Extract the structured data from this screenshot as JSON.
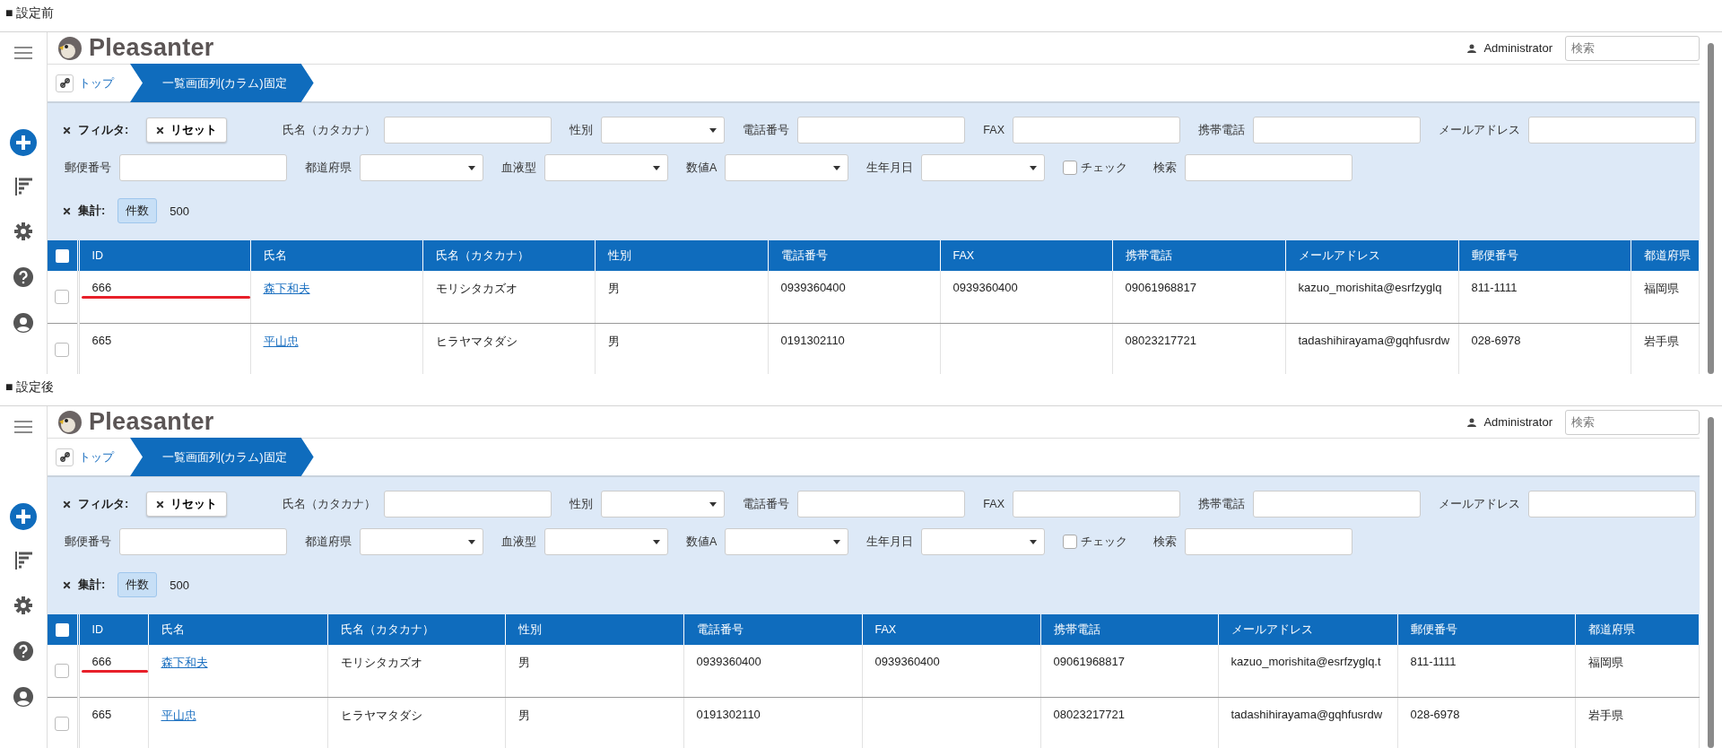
{
  "panels": [
    {
      "caption": "■ 設定前",
      "id_column_narrow": false,
      "logo": {
        "text": "Pleasanter"
      },
      "user": {
        "name": "Administrator"
      },
      "search": {
        "placeholder": "検索"
      },
      "breadcrumb": [
        {
          "kind": "link",
          "label": "トップ"
        },
        {
          "kind": "current",
          "label": "一覧画面列(カラム)固定"
        }
      ],
      "filter": {
        "title": "フィルタ:",
        "reset": "リセット",
        "lines": [
          {
            "fields": [
              {
                "kind": "text",
                "label": "氏名（カタカナ）"
              },
              {
                "kind": "select",
                "label": "性別"
              },
              {
                "kind": "text",
                "label": "電話番号"
              },
              {
                "kind": "text",
                "label": "FAX"
              },
              {
                "kind": "text",
                "label": "携帯電話"
              },
              {
                "kind": "text",
                "label": "メールアドレス"
              }
            ]
          },
          {
            "fields": [
              {
                "kind": "text",
                "label": "郵便番号"
              },
              {
                "kind": "select",
                "label": "都道府県"
              },
              {
                "kind": "select",
                "label": "血液型"
              },
              {
                "kind": "select",
                "label": "数値A"
              },
              {
                "kind": "select",
                "label": "生年月日"
              },
              {
                "kind": "checkbox",
                "label": "チェック",
                "checked": false
              },
              {
                "kind": "text",
                "label": "検索"
              }
            ]
          }
        ]
      },
      "aggregation": {
        "title": "集計:",
        "type": "件数",
        "count": "500"
      },
      "table": {
        "all_selected": false,
        "columns": [
          {
            "label": "ID",
            "kind": "text"
          },
          {
            "label": "氏名",
            "kind": "link"
          },
          {
            "label": "氏名（カタカナ）",
            "kind": "text"
          },
          {
            "label": "性別",
            "kind": "text"
          },
          {
            "label": "電話番号",
            "kind": "text"
          },
          {
            "label": "FAX",
            "kind": "text"
          },
          {
            "label": "携帯電話",
            "kind": "text"
          },
          {
            "label": "メールアドレス",
            "kind": "text"
          },
          {
            "label": "郵便番号",
            "kind": "text"
          },
          {
            "label": "都道府県",
            "kind": "text"
          }
        ],
        "rows": [
          {
            "selected": false,
            "id_underlined": true,
            "cells": [
              "666",
              "森下和夫",
              "モリシタカズオ",
              "男",
              "0939360400",
              "0939360400",
              "09061968817",
              "kazuo_morishita@esrfzyglq",
              "811-1111",
              "福岡県"
            ]
          },
          {
            "selected": false,
            "id_underlined": false,
            "cells": [
              "665",
              "平山忠",
              "ヒラヤマタダシ",
              "男",
              "0191302110",
              null,
              "08023217721",
              "tadashihirayama@gqhfusrdw",
              "028-6978",
              "岩手県"
            ]
          }
        ]
      }
    },
    {
      "caption": "■ 設定後",
      "id_column_narrow": true,
      "logo": {
        "text": "Pleasanter"
      },
      "user": {
        "name": "Administrator"
      },
      "search": {
        "placeholder": "検索"
      },
      "breadcrumb": [
        {
          "kind": "link",
          "label": "トップ"
        },
        {
          "kind": "current",
          "label": "一覧画面列(カラム)固定"
        }
      ],
      "filter": {
        "title": "フィルタ:",
        "reset": "リセット",
        "lines": [
          {
            "fields": [
              {
                "kind": "text",
                "label": "氏名（カタカナ）"
              },
              {
                "kind": "select",
                "label": "性別"
              },
              {
                "kind": "text",
                "label": "電話番号"
              },
              {
                "kind": "text",
                "label": "FAX"
              },
              {
                "kind": "text",
                "label": "携帯電話"
              },
              {
                "kind": "text",
                "label": "メールアドレス"
              }
            ]
          },
          {
            "fields": [
              {
                "kind": "text",
                "label": "郵便番号"
              },
              {
                "kind": "select",
                "label": "都道府県"
              },
              {
                "kind": "select",
                "label": "血液型"
              },
              {
                "kind": "select",
                "label": "数値A"
              },
              {
                "kind": "select",
                "label": "生年月日"
              },
              {
                "kind": "checkbox",
                "label": "チェック",
                "checked": false
              },
              {
                "kind": "text",
                "label": "検索"
              }
            ]
          }
        ]
      },
      "aggregation": {
        "title": "集計:",
        "type": "件数",
        "count": "500"
      },
      "table": {
        "all_selected": false,
        "columns": [
          {
            "label": "ID",
            "kind": "text"
          },
          {
            "label": "氏名",
            "kind": "link"
          },
          {
            "label": "氏名（カタカナ）",
            "kind": "text"
          },
          {
            "label": "性別",
            "kind": "text"
          },
          {
            "label": "電話番号",
            "kind": "text"
          },
          {
            "label": "FAX",
            "kind": "text"
          },
          {
            "label": "携帯電話",
            "kind": "text"
          },
          {
            "label": "メールアドレス",
            "kind": "text"
          },
          {
            "label": "郵便番号",
            "kind": "text"
          },
          {
            "label": "都道府県",
            "kind": "text"
          }
        ],
        "rows": [
          {
            "selected": false,
            "id_underlined": true,
            "cells": [
              "666",
              "森下和夫",
              "モリシタカズオ",
              "男",
              "0939360400",
              "0939360400",
              "09061968817",
              "kazuo_morishita@esrfzyglq.t",
              "811-1111",
              "福岡県"
            ]
          },
          {
            "selected": false,
            "id_underlined": false,
            "cells": [
              "665",
              "平山忠",
              "ヒラヤマタダシ",
              "男",
              "0191302110",
              null,
              "08023217721",
              "tadashihirayama@gqhfusrdw",
              "028-6978",
              "岩手県"
            ]
          }
        ]
      }
    }
  ]
}
